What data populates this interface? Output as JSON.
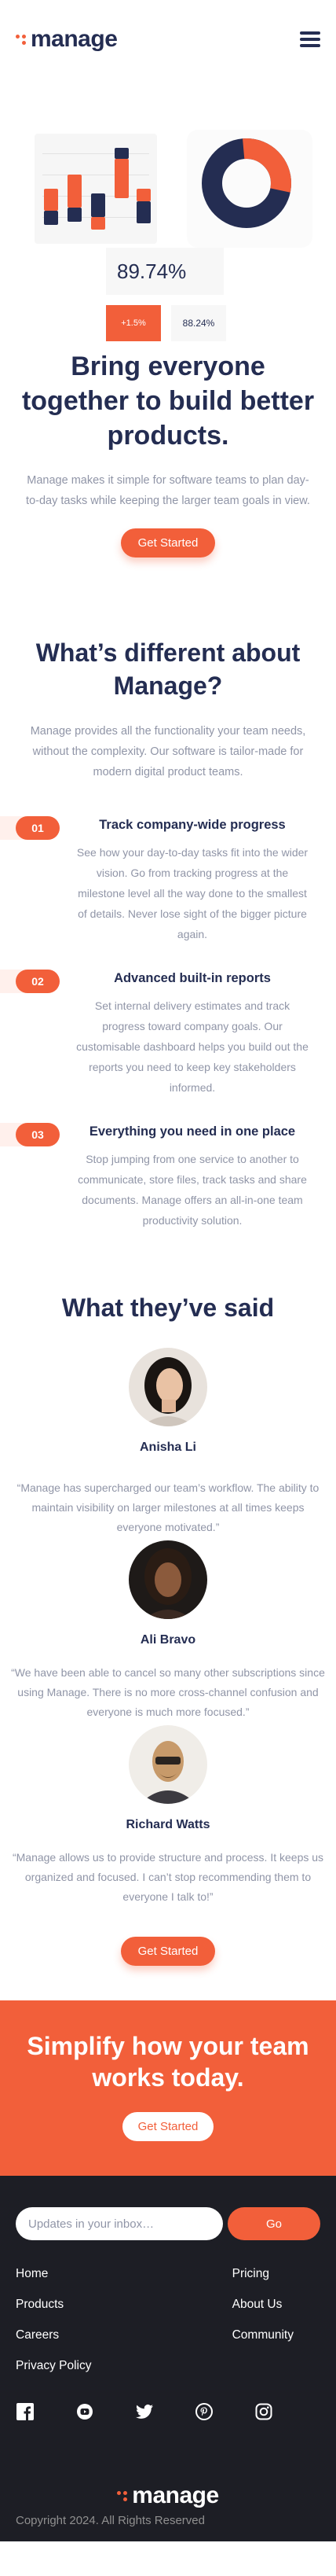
{
  "brand": {
    "name": "manage",
    "accent": "#f25f3a",
    "navy": "#242d52"
  },
  "header": {
    "menu_icon": "hamburger-icon"
  },
  "illustration": {
    "big_stat": "89.74%",
    "stat_positive": "+1.5%",
    "stat_secondary": "88.24%"
  },
  "hero": {
    "title": "Bring everyone together to build better products.",
    "description": "Manage makes it simple for software teams to plan day-to-day tasks while keeping the larger team goals in view.",
    "cta": "Get Started"
  },
  "difference": {
    "title": "What’s different about Manage?",
    "description": "Manage provides all the functionality your team needs, without the complexity. Our software is tailor-made for modern digital product teams.",
    "features": [
      {
        "num": "01",
        "title": "Track company-wide progress",
        "text": "See how your day-to-day tasks fit into the wider vision. Go from tracking progress at the milestone level all the way done to the smallest of details. Never lose sight of the bigger picture again."
      },
      {
        "num": "02",
        "title": "Advanced built-in reports",
        "text": "Set internal delivery estimates and track progress toward company goals. Our customisable dashboard helps you build out the reports you need to keep key stakeholders informed."
      },
      {
        "num": "03",
        "title": "Everything you need in one place",
        "text": "Stop jumping from one service to another to communicate, store files, track tasks and share documents. Manage offers an all-in-one team productivity solution."
      }
    ]
  },
  "testimonials": {
    "title": "What they’ve said",
    "items": [
      {
        "name": "Anisha Li",
        "quote": "“Manage has supercharged our team’s workflow. The ability to maintain visibility on larger milestones at all times keeps everyone motivated.”"
      },
      {
        "name": "Ali Bravo",
        "quote": "“We have been able to cancel so many other subscriptions since using Manage. There is no more cross-channel confusion and everyone is much more focused.”"
      },
      {
        "name": "Richard Watts",
        "quote": "“Manage allows us to provide structure and process. It keeps us organized and focused. I can’t stop recommending them to everyone I talk to!”"
      }
    ],
    "cta": "Get Started"
  },
  "cta_banner": {
    "title": "Simplify how your team works today.",
    "button": "Get Started"
  },
  "footer": {
    "newsletter_placeholder": "Updates in your inbox…",
    "go": "Go",
    "links_left": [
      "Home",
      "Products",
      "Careers",
      "Privacy Policy"
    ],
    "links_right": [
      "Pricing",
      "About Us",
      "Community"
    ],
    "socials": [
      "facebook-icon",
      "youtube-icon",
      "twitter-icon",
      "pinterest-icon",
      "instagram-icon"
    ],
    "copyright": "Copyright 2024. All Rights Reserved"
  }
}
